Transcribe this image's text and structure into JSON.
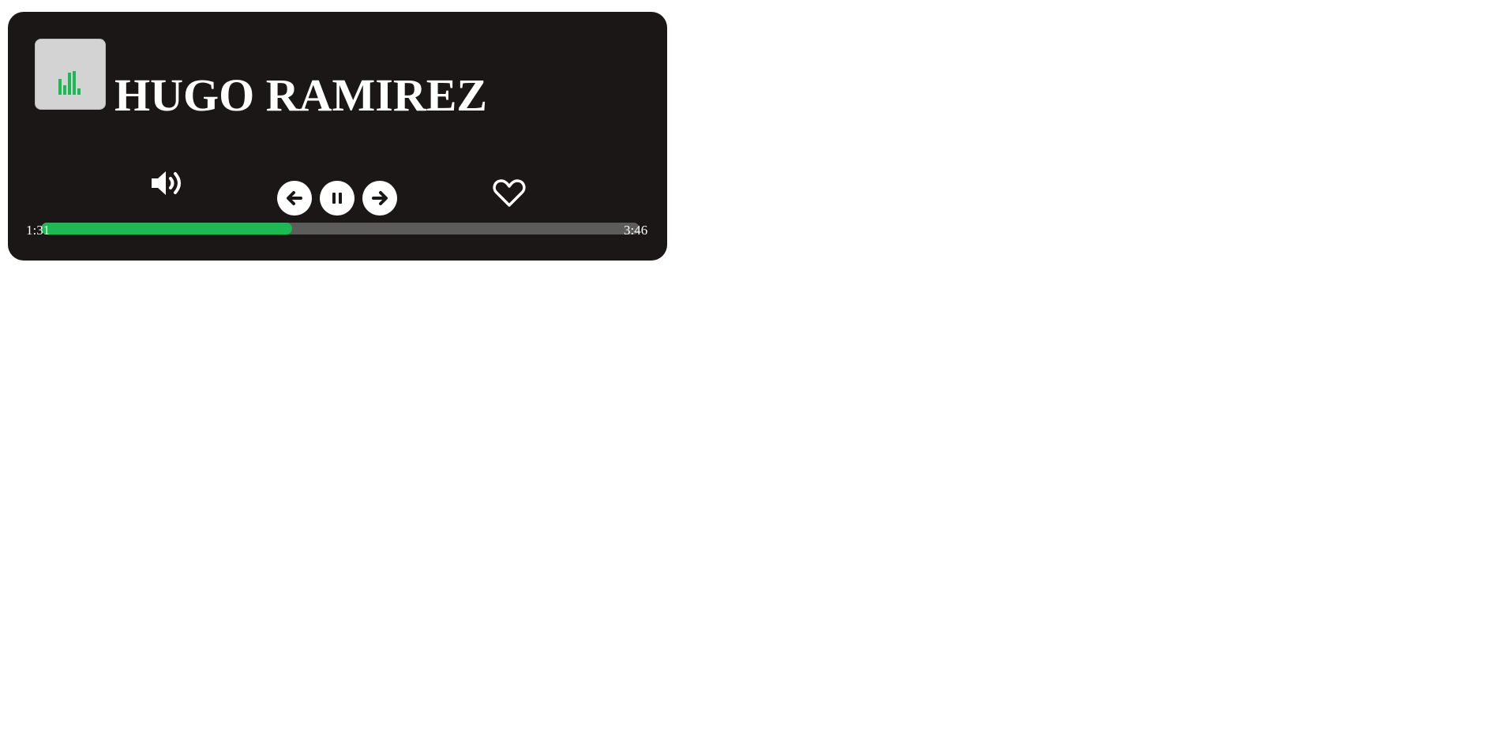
{
  "track": {
    "title": "HUGO RAMIREZ"
  },
  "album_art": {
    "icon": "equalizer-bars-icon",
    "icon_color": "#1db954",
    "background_color": "#d3d3d3"
  },
  "controls": {
    "volume_icon": "volume-icon",
    "previous_icon": "arrow-left-icon",
    "pause_icon": "pause-icon",
    "next_icon": "arrow-right-icon",
    "like_icon": "heart-icon"
  },
  "progress": {
    "current_time": "1:31",
    "total_time": "3:46",
    "fraction": 0.42,
    "fill_color": "#1db954",
    "track_color": "#5e5c5b"
  },
  "colors": {
    "panel": "#1b1716",
    "text": "#ffffff"
  }
}
